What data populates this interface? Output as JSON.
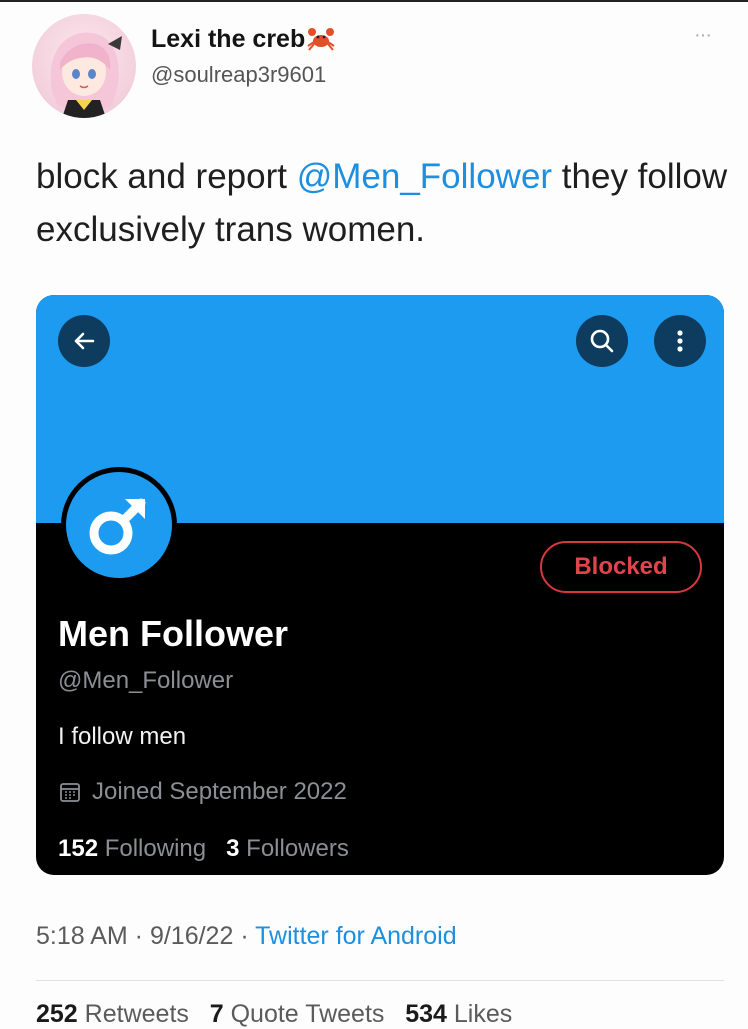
{
  "tweet": {
    "author_name": "Lexi the creb",
    "author_handle": "@soulreap3r9601",
    "more_label": "···",
    "text_before": "block and report ",
    "mention": "@Men_Follower",
    "text_after": " they follow exclusively trans women.",
    "time": "5:18 AM",
    "date": "9/16/22",
    "source": "Twitter for Android",
    "separator": " · ",
    "retweets_count": "252",
    "retweets_label": "Retweets",
    "quote_count": "7",
    "quote_label": "Quote Tweets",
    "likes_count": "534",
    "likes_label": "Likes"
  },
  "profile": {
    "name": "Men Follower",
    "handle": "@Men_Follower",
    "bio": "I follow men",
    "joined": "Joined September 2022",
    "following_count": "152",
    "following_label": "Following",
    "followers_count": "3",
    "followers_label": "Followers",
    "blocked_label": "Blocked"
  },
  "icons": {
    "avatar": "anime-girl-avatar",
    "crab": "crab-emoji-icon",
    "back": "arrow-left-icon",
    "search": "search-icon",
    "menu": "vertical-dots-icon",
    "profile_avatar": "male-symbol-icon",
    "calendar": "calendar-icon"
  },
  "colors": {
    "accent": "#1d9bf0",
    "link": "#1d8fe0",
    "blocked": "#e0454c",
    "card_background": "#000000"
  }
}
